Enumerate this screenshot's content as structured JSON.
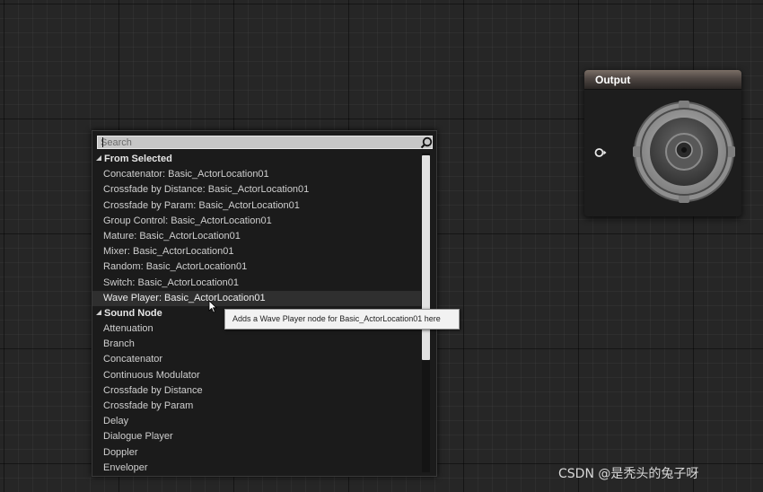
{
  "output_node": {
    "title": "Output",
    "icon": "speaker-icon",
    "pin_icon": "exec-pin-icon"
  },
  "action_menu": {
    "search": {
      "placeholder": "Search",
      "value": "",
      "icon": "search-icon"
    },
    "categories": [
      {
        "label": "From Selected",
        "items": [
          "Concatenator: Basic_ActorLocation01",
          "Crossfade by Distance: Basic_ActorLocation01",
          "Crossfade by Param: Basic_ActorLocation01",
          "Group Control: Basic_ActorLocation01",
          "Mature: Basic_ActorLocation01",
          "Mixer: Basic_ActorLocation01",
          "Random: Basic_ActorLocation01",
          "Switch: Basic_ActorLocation01",
          "Wave Player: Basic_ActorLocation01"
        ]
      },
      {
        "label": "Sound Node",
        "items": [
          "Attenuation",
          "Branch",
          "Concatenator",
          "Continuous Modulator",
          "Crossfade by Distance",
          "Crossfade by Param",
          "Delay",
          "Dialogue Player",
          "Doppler",
          "Enveloper"
        ]
      }
    ],
    "hovered_item": "Wave Player: Basic_ActorLocation01"
  },
  "tooltip": {
    "text": "Adds a Wave Player node for Basic_ActorLocation01 here"
  },
  "watermark": {
    "text": "CSDN @是秃头的兔子呀"
  },
  "colors": {
    "background": "#262626",
    "menu_background": "#1b1b1b",
    "search_background": "#c6c6c6",
    "tooltip_background": "#f2f2f2",
    "output_header": "#5a504b"
  }
}
